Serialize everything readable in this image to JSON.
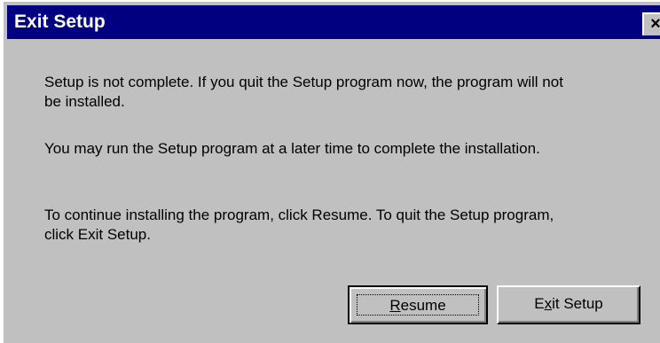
{
  "window": {
    "title": "Exit Setup",
    "close_label": "×"
  },
  "message": {
    "line1": "Setup is not complete.  If you quit the Setup program now, the program will not",
    "line2": "be installed.",
    "line3": "You may run the Setup program at a later time to complete the installation.",
    "line4": "To continue installing the program, click Resume.  To quit the Setup program,",
    "line5": "click Exit Setup."
  },
  "buttons": {
    "resume": {
      "mnemonic": "R",
      "rest": "esume",
      "focused": true
    },
    "exit": {
      "before": "E",
      "mnemonic": "x",
      "rest": "it Setup"
    }
  },
  "colors": {
    "titlebar": "#000080",
    "face": "#c0c0c0",
    "text": "#000000"
  },
  "icons": {
    "close": "close-icon"
  }
}
